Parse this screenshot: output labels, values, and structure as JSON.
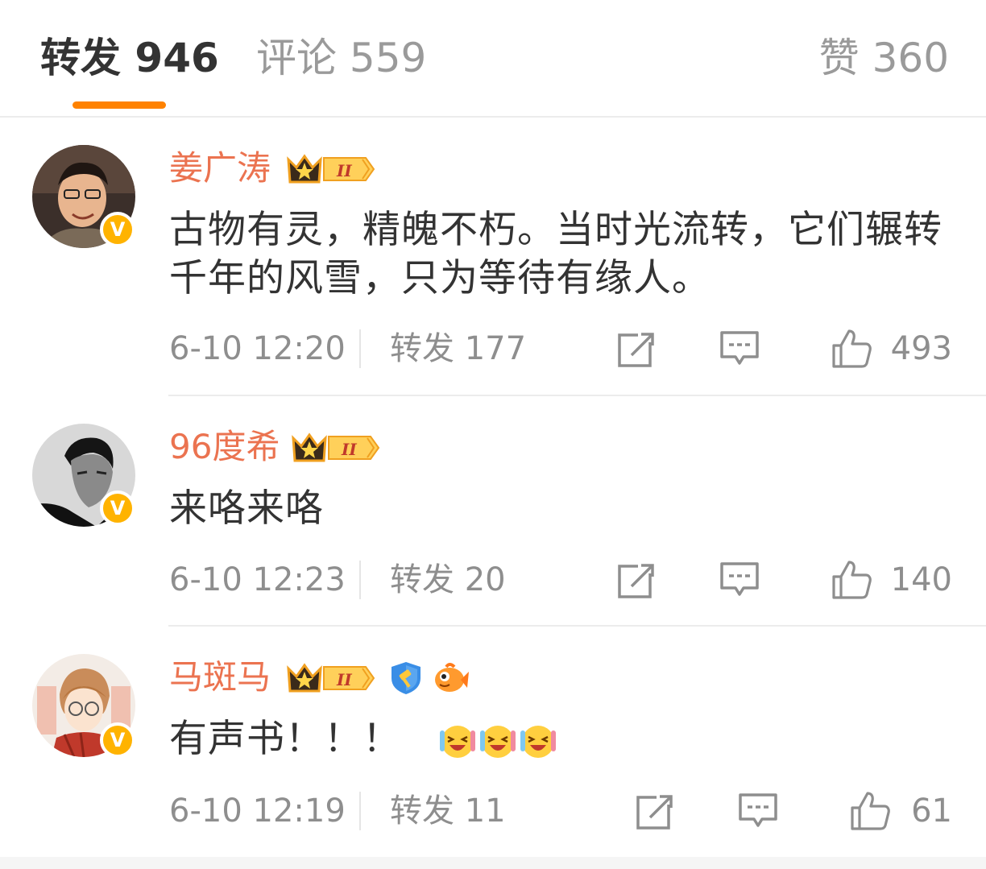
{
  "tabs": {
    "repost": "转发 946",
    "comment": "评论 559",
    "like": "赞 360",
    "accent_color": "#ff8200"
  },
  "reposts": [
    {
      "username": "姜广涛",
      "text": "古物有灵，精魄不朽。当时光流转，它们辗转千年的风雪，只为等待有缘人。",
      "time": "6-10 12:20",
      "repost_label": "转发 177",
      "likes": "493",
      "verified_icon": "v-badge-icon",
      "level_icon": "crown-level-badge-icon"
    },
    {
      "username": "96度希",
      "text": "来咯来咯",
      "time": "6-10 12:23",
      "repost_label": "转发 20",
      "likes": "140",
      "verified_icon": "v-badge-icon",
      "level_icon": "crown-level-badge-icon"
    },
    {
      "username": "马斑马",
      "text": "有声书！！！",
      "emoji": [
        "laugh-cry-emoji",
        "laugh-cry-emoji",
        "laugh-cry-emoji"
      ],
      "time": "6-10 12:19",
      "repost_label": "转发 11",
      "likes": "61",
      "verified_icon": "v-badge-icon",
      "level_icon": "crown-level-badge-icon",
      "extra_icons": [
        "shield-hammer-icon",
        "goldfish-icon"
      ]
    }
  ],
  "level_badge": "II",
  "colors": {
    "username": "#eb7350",
    "text": "#333333",
    "meta": "#8e8e8e",
    "verified": "#ffb300"
  }
}
